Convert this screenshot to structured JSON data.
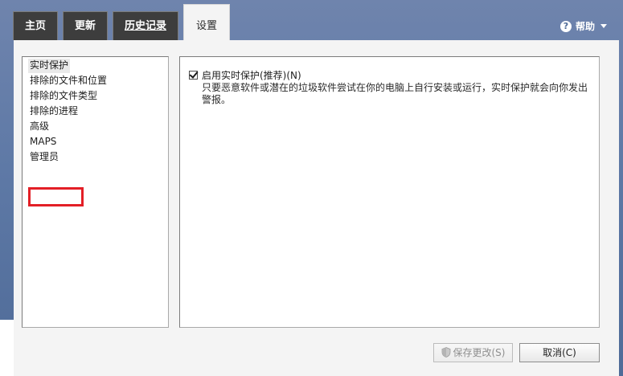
{
  "tabs": {
    "home": "主页",
    "update": "更新",
    "history": "历史记录",
    "settings": "设置"
  },
  "help": {
    "label": "帮助",
    "icon": "help-icon"
  },
  "nav": {
    "items": [
      {
        "label": "实时保护",
        "selected": true
      },
      {
        "label": "排除的文件和位置",
        "selected": false
      },
      {
        "label": "排除的文件类型",
        "selected": false
      },
      {
        "label": "排除的进程",
        "selected": false
      },
      {
        "label": "高级",
        "selected": false
      },
      {
        "label": "MAPS",
        "selected": false
      },
      {
        "label": "管理员",
        "selected": false
      }
    ]
  },
  "realtime": {
    "checkbox_label": "启用实时保护(推荐)(N)",
    "checked": true,
    "description": "只要恶意软件或潜在的垃圾软件尝试在你的电脑上自行安装或运行，实时保护就会向你发出警报。"
  },
  "footer": {
    "save_label": "保存更改(S)",
    "cancel_label": "取消(C)",
    "save_enabled": false
  },
  "colors": {
    "tab_inactive": "#3d3d3d",
    "highlight": "#e31f26",
    "background_blue": "#5e79a6"
  }
}
